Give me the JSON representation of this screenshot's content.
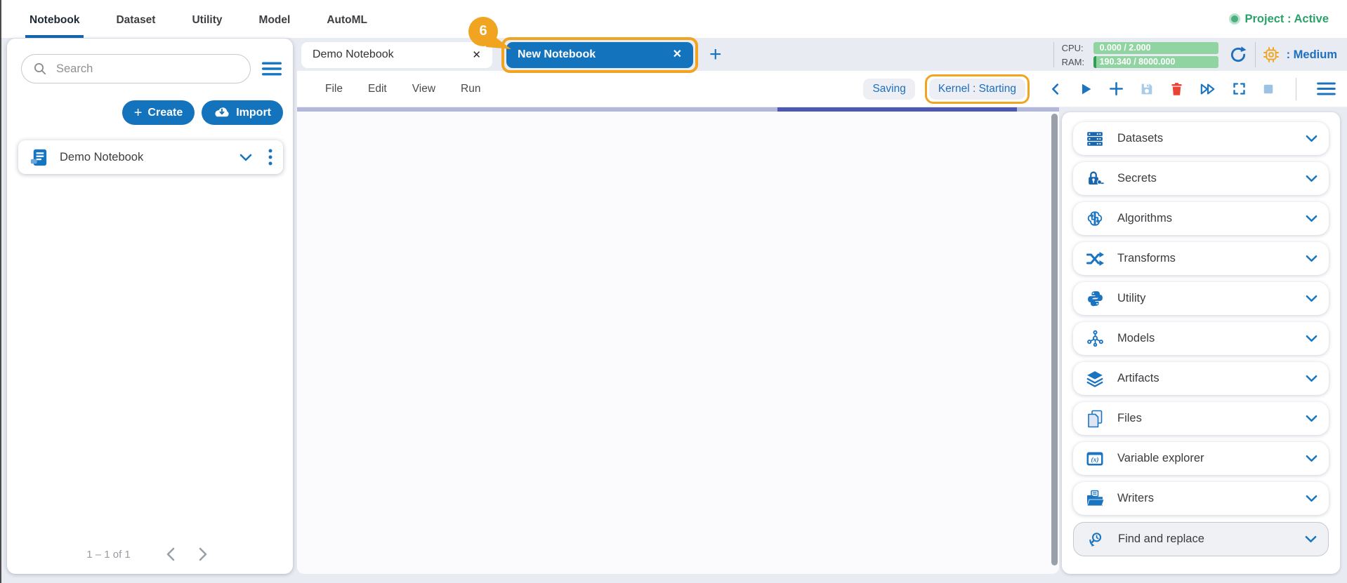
{
  "icons": {
    "close": "✕",
    "plus": "+"
  },
  "header": {
    "nav": [
      {
        "label": "Notebook"
      },
      {
        "label": "Dataset"
      },
      {
        "label": "Utility"
      },
      {
        "label": "Model"
      },
      {
        "label": "AutoML"
      }
    ],
    "project_status": "Project : Active"
  },
  "sidebar": {
    "search_placeholder": "Search",
    "create_label": "Create",
    "import_label": "Import",
    "notebook_item": "Demo Notebook",
    "pagination": "1 – 1 of 1"
  },
  "tabs": [
    {
      "label": "Demo Notebook"
    },
    {
      "label": "New Notebook"
    }
  ],
  "annotation": {
    "step": "6"
  },
  "toolbar": {
    "menus": [
      {
        "label": "File"
      },
      {
        "label": "Edit"
      },
      {
        "label": "View"
      },
      {
        "label": "Run"
      }
    ],
    "status_label": "Saving",
    "kernel_label": "Kernel : Starting"
  },
  "resources": {
    "cpu_label": "CPU:",
    "cpu_value": "0.000 / 2.000",
    "ram_label": "RAM:",
    "ram_value": "190.340 / 8000.000",
    "instance_label": ": Medium"
  },
  "right_panel": {
    "items": [
      {
        "label": "Datasets"
      },
      {
        "label": "Secrets"
      },
      {
        "label": "Algorithms"
      },
      {
        "label": "Transforms"
      },
      {
        "label": "Utility"
      },
      {
        "label": "Models"
      },
      {
        "label": "Artifacts"
      },
      {
        "label": "Files"
      },
      {
        "label": "Variable explorer"
      },
      {
        "label": "Writers"
      },
      {
        "label": "Find and replace"
      }
    ]
  },
  "colors": {
    "accent_blue": "#1473bd",
    "annotation_orange": "#f0a41f",
    "status_green": "#2aa268",
    "pill_green": "#90d4a1",
    "progress_indigo": "#4c57b6",
    "danger_red": "#ea4335"
  }
}
